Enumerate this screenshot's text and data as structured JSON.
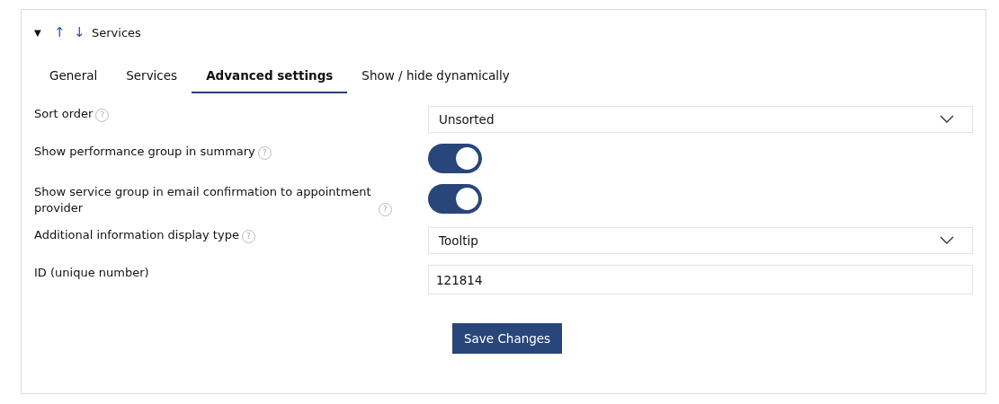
{
  "header": {
    "collapse_icon": "▼",
    "move_up": "↑",
    "move_down": "↓",
    "title": "Services"
  },
  "tabs": [
    {
      "label": "General",
      "selected": false
    },
    {
      "label": "Services",
      "selected": false
    },
    {
      "label": "Advanced settings",
      "selected": true
    },
    {
      "label": "Show / hide dynamically",
      "selected": false
    }
  ],
  "fields": [
    {
      "kind": "select",
      "label": "Sort order",
      "help": "?",
      "value": "Unsorted"
    },
    {
      "kind": "toggle",
      "label": "Show performance group in summary",
      "help": "?",
      "on": true
    },
    {
      "kind": "toggle",
      "label": "Show service group in email confirmation to appointment provider",
      "help": "?",
      "on": true
    },
    {
      "kind": "select",
      "label": "Additional information display type",
      "help": "?",
      "value": "Tooltip"
    },
    {
      "kind": "input",
      "label": "ID (unique number)",
      "value": "121814"
    }
  ],
  "save_button": "Save Changes"
}
